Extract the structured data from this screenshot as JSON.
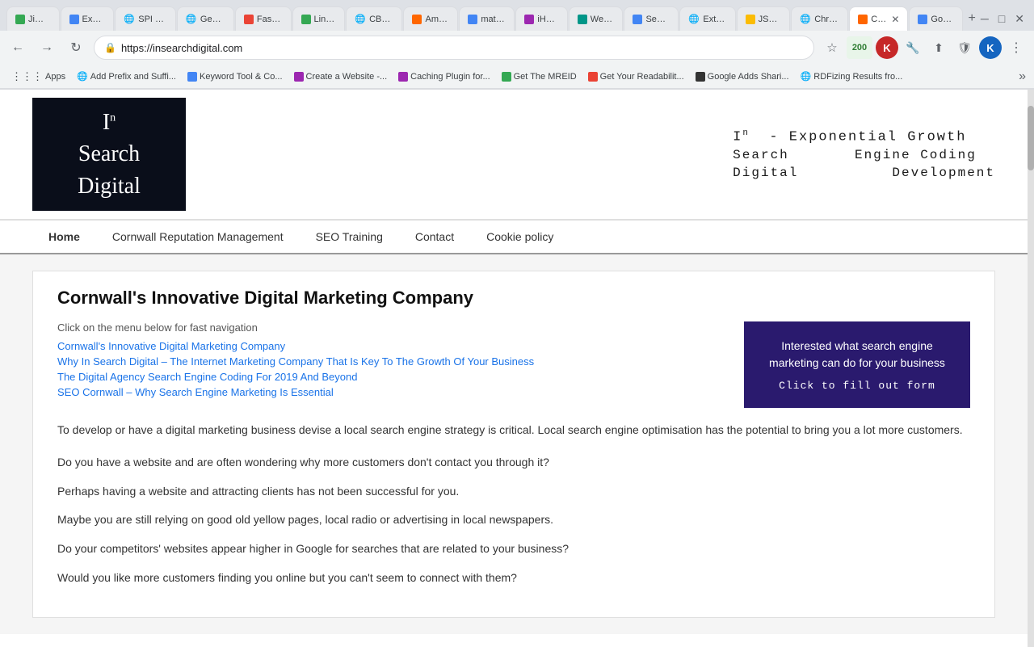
{
  "browser": {
    "url": "https://insearchdigital.com",
    "tabs": [
      {
        "id": 1,
        "label": "Jimr...",
        "favicon": "green",
        "active": false
      },
      {
        "id": 2,
        "label": "Expi...",
        "favicon": "blue",
        "active": false
      },
      {
        "id": 3,
        "label": "SPI C...",
        "favicon": "globe",
        "active": false
      },
      {
        "id": 4,
        "label": "Geor...",
        "favicon": "globe",
        "active": false
      },
      {
        "id": 5,
        "label": "Fash...",
        "favicon": "red",
        "active": false
      },
      {
        "id": 6,
        "label": "Link...",
        "favicon": "green",
        "active": false
      },
      {
        "id": 7,
        "label": "CBD...",
        "favicon": "globe",
        "active": false
      },
      {
        "id": 8,
        "label": "Ama...",
        "favicon": "orange",
        "active": false
      },
      {
        "id": 9,
        "label": "matc...",
        "favicon": "blue",
        "active": false
      },
      {
        "id": 10,
        "label": "iHO...",
        "favicon": "purple",
        "active": false
      },
      {
        "id": 11,
        "label": "Web...",
        "favicon": "teal",
        "active": false
      },
      {
        "id": 12,
        "label": "Sear...",
        "favicon": "blue",
        "active": false
      },
      {
        "id": 13,
        "label": "Exte...",
        "favicon": "globe",
        "active": false
      },
      {
        "id": 14,
        "label": "JSO...",
        "favicon": "yellow",
        "active": false
      },
      {
        "id": 15,
        "label": "Chro...",
        "favicon": "globe",
        "active": false
      },
      {
        "id": 16,
        "label": "CHA",
        "favicon": "active",
        "active": true
      },
      {
        "id": 17,
        "label": "Goo...",
        "favicon": "blue",
        "active": false
      }
    ],
    "bookmarks": [
      {
        "label": "Apps",
        "icon": "grid"
      },
      {
        "label": "Add Prefix and Suffi...",
        "icon": "globe"
      },
      {
        "label": "Keyword Tool & Co...",
        "icon": "blue"
      },
      {
        "label": "Create a Website -...",
        "icon": "purple"
      },
      {
        "label": "Caching Plugin for...",
        "icon": "purple"
      },
      {
        "label": "Get The MREID",
        "icon": "green"
      },
      {
        "label": "Get Your Readabilit...",
        "icon": "red"
      },
      {
        "label": "Google Adds Shari...",
        "icon": "dark"
      },
      {
        "label": "RDFizing Results fro...",
        "icon": "globe"
      }
    ]
  },
  "site": {
    "logo": {
      "line1": "I",
      "sup": "n",
      "line2": "Search",
      "line3": "Digital"
    },
    "tagline": {
      "line1": "Iⁿ  - Exponential Growth",
      "line2": "Search       Engine Coding",
      "line3": "Digital          Development"
    },
    "nav": [
      {
        "label": "Home",
        "active": true
      },
      {
        "label": "Cornwall Reputation Management",
        "active": false
      },
      {
        "label": "SEO Training",
        "active": false
      },
      {
        "label": "Contact",
        "active": false
      },
      {
        "label": "Cookie policy",
        "active": false
      }
    ],
    "main": {
      "heading": "Cornwall's Innovative Digital Marketing Company",
      "nav_intro": "Click on the menu below for fast navigation",
      "nav_links": [
        "Cornwall's Innovative Digital Marketing Company",
        "Why In Search Digital – The Internet Marketing Company That Is Key To The Growth Of Your Business",
        "The Digital Agency Search Engine Coding For 2019 And Beyond",
        "SEO Cornwall – Why Search Engine Marketing Is Essential"
      ],
      "cta": {
        "text": "Interested what search engine marketing can do for your business",
        "button": "Click to fill out form"
      },
      "paragraphs": [
        "To develop or have a digital marketing business devise a local search engine strategy is critical. Local search engine optimisation has the potential to bring you a lot more customers.",
        "Do you have a website and are often wondering why more customers don't contact you through it?\nPerhaps having a website and attracting clients has not been successful for you.\nMaybe you are still relying on good old yellow pages, local radio or advertising in local newspapers.\nDo your competitors' websites appear higher in Google for searches that are related to your business?\nWould you like more customers finding you online but you can't seem to connect with them?"
      ]
    }
  }
}
